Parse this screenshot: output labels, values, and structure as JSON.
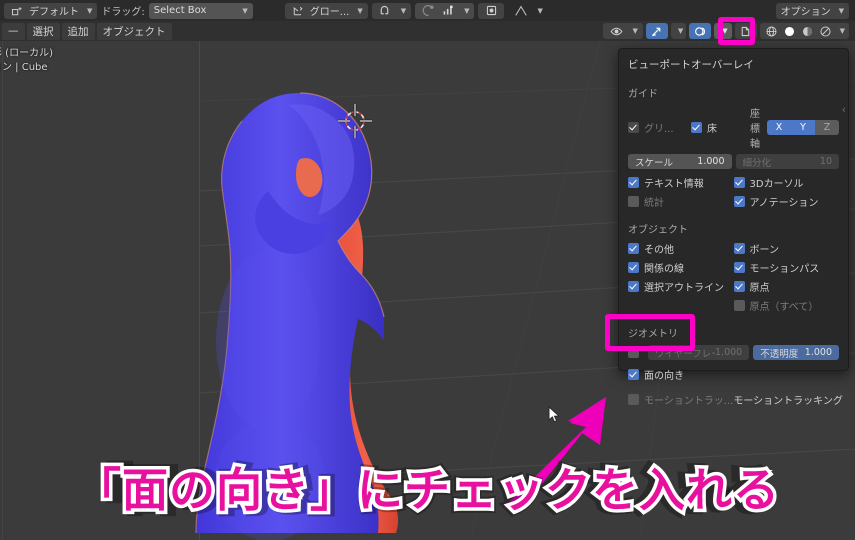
{
  "app": {
    "name": "Blender 3D Viewport"
  },
  "topbar": {
    "mode_button": {
      "label": "デフォルト",
      "icon": "object-mode-icon"
    },
    "drag_label": "ドラッグ:",
    "drag_select": {
      "value": "Select Box"
    },
    "transform_orientation": {
      "label": "グロー...",
      "icon": "orientation-icon"
    },
    "snap": {
      "icon": "magnet-icon"
    },
    "proportional": {
      "icon": "proportional-edit-icon"
    },
    "proportional_falloff": {
      "icon": "falloff-icon"
    },
    "snap_target": {
      "icon": "snap-dot-icon"
    },
    "falloff_curve": {
      "icon": "curve-icon"
    },
    "options_button": {
      "label": "オプション"
    }
  },
  "menubar": {
    "items": [
      {
        "label": "—"
      },
      {
        "label": "選択"
      },
      {
        "label": "追加"
      },
      {
        "label": "オブジェクト"
      }
    ]
  },
  "viewport_header_right": {
    "visibility": {
      "icon": "eye-icon"
    },
    "gizmo": {
      "icon": "gizmo-arrow-icon",
      "active": true
    },
    "overlays": {
      "icon": "overlay-icon",
      "active": true
    },
    "overlays_dropdown": {
      "icon": "chevron-down-icon",
      "highlighted": true
    },
    "xray": {
      "icon": "xray-icon"
    },
    "shading_wireframe": {
      "icon": "wireframe-globe-icon"
    },
    "shading_solid": {
      "icon": "solid-sphere-icon",
      "active": true
    },
    "shading_material": {
      "icon": "material-preview-icon"
    },
    "shading_rendered": {
      "icon": "rendered-icon"
    },
    "shading_dropdown": {
      "icon": "chevron-down-icon"
    }
  },
  "viewport_info": {
    "line1": "投影 (ローカル)",
    "line2": "ション | Cube"
  },
  "overlay_panel": {
    "title": "ビューポートオーバーレイ",
    "sections": [
      {
        "name": "ガイド",
        "heading": "ガイド",
        "rows": [
          {
            "type": "checkbox_pair_axis",
            "left": {
              "label": "グリ...",
              "checked": true,
              "disabled": true
            },
            "right": {
              "label": "床",
              "checked": true,
              "disabled": false
            },
            "axis": {
              "label": "座標軸",
              "buttons": [
                {
                  "label": "X",
                  "active": true
                },
                {
                  "label": "Y",
                  "active": true
                },
                {
                  "label": "Z",
                  "active": false
                }
              ]
            }
          },
          {
            "type": "numfields",
            "left": {
              "label": "スケール",
              "value": "1.000",
              "dim": false
            },
            "right": {
              "label": "細分化",
              "value": "10",
              "dim": true
            }
          },
          {
            "type": "checkbox_pair",
            "left": {
              "label": "テキスト情報",
              "checked": true
            },
            "right": {
              "label": "3Dカーソル",
              "checked": true
            }
          },
          {
            "type": "checkbox_pair",
            "left": {
              "label": "統計",
              "checked": false
            },
            "right": {
              "label": "アノテーション",
              "checked": true
            }
          }
        ]
      },
      {
        "name": "オブジェクト",
        "heading": "オブジェクト",
        "rows": [
          {
            "type": "checkbox_pair",
            "left": {
              "label": "その他",
              "checked": true
            },
            "right": {
              "label": "ボーン",
              "checked": true
            }
          },
          {
            "type": "checkbox_pair",
            "left": {
              "label": "関係の線",
              "checked": true
            },
            "right": {
              "label": "モーションパス",
              "checked": true
            }
          },
          {
            "type": "checkbox_pair",
            "left": {
              "label": "選択アウトライン",
              "checked": true
            },
            "right": {
              "label": "原点",
              "checked": true
            }
          },
          {
            "type": "checkbox_pair",
            "left": {
              "label": "",
              "checked": null
            },
            "right": {
              "label": "原点（すべて）",
              "checked": false
            }
          }
        ]
      },
      {
        "name": "ジオメトリ",
        "heading": "ジオメトリ",
        "rows": [
          {
            "type": "numfields_checkbox",
            "check": {
              "checked": false
            },
            "left": {
              "label": "ワイヤーフレーム",
              "value": "1.000",
              "dim": true
            },
            "right": {
              "label": "不透明度",
              "value": "1.000",
              "dim": false
            }
          },
          {
            "type": "checkbox_single",
            "left": {
              "label": "面の向き",
              "checked": true,
              "highlighted": true
            }
          },
          {
            "type": "checkbox_text",
            "left": {
              "label": "モーショントラッ...",
              "checked": false
            },
            "right": {
              "label": "モーショントラッキング"
            }
          }
        ]
      }
    ]
  },
  "annotations": {
    "caption": "「面の向き」にチェックを入れる",
    "highlight_color": "#ff00c8",
    "caption_color": "#e8109e",
    "caption_outline": "#ffffff",
    "arrow": {
      "name": "pointer-arrow",
      "color": "#ee00bb"
    }
  },
  "viewport_model": {
    "front_face_color": "#4f45e8",
    "back_face_color": "#e8503c",
    "background_color": "#3b3b3b",
    "cursor_3d": "3d-cursor-icon"
  }
}
